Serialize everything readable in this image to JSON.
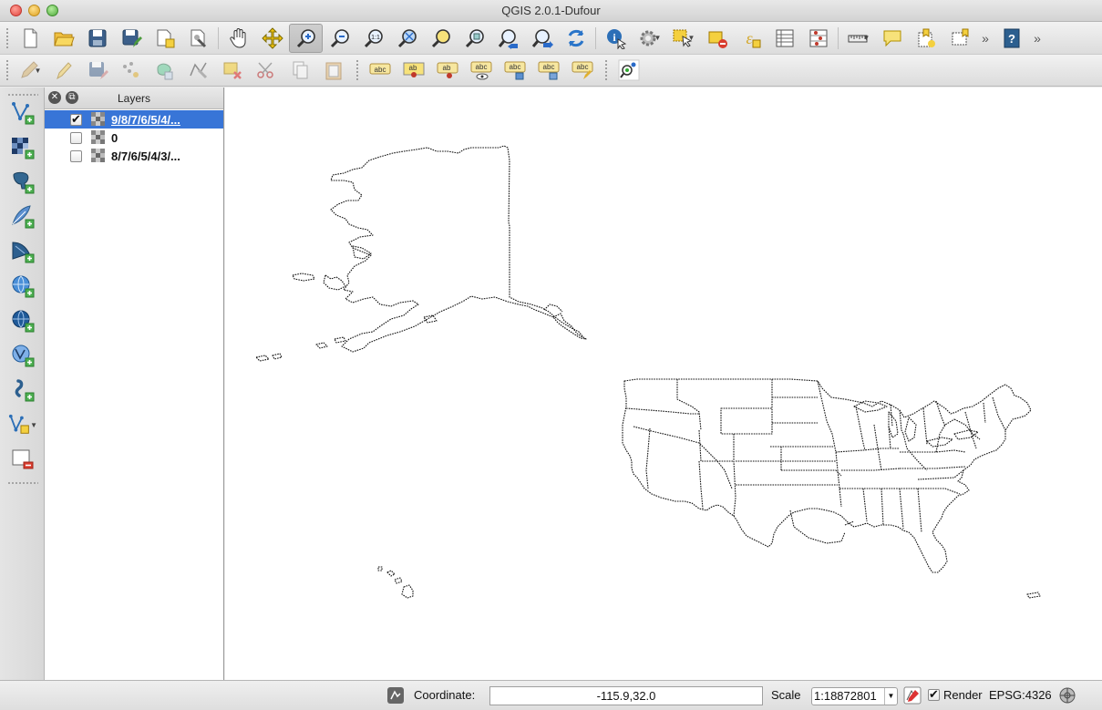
{
  "window": {
    "title": "QGIS 2.0.1-Dufour"
  },
  "toolbar1": {
    "buttons": [
      {
        "name": "new-project-icon"
      },
      {
        "name": "open-project-icon"
      },
      {
        "name": "save-project-icon"
      },
      {
        "name": "save-as-icon"
      },
      {
        "name": "new-print-composer-icon"
      },
      {
        "name": "composer-manager-icon"
      },
      {
        "name": "pan-map-icon"
      },
      {
        "name": "pan-to-selection-icon"
      },
      {
        "name": "zoom-in-icon",
        "active": true
      },
      {
        "name": "zoom-out-icon"
      },
      {
        "name": "zoom-actual-size-icon"
      },
      {
        "name": "zoom-full-icon"
      },
      {
        "name": "zoom-to-selection-icon"
      },
      {
        "name": "zoom-to-layer-icon"
      },
      {
        "name": "zoom-last-icon"
      },
      {
        "name": "zoom-next-icon"
      },
      {
        "name": "refresh-icon"
      },
      {
        "name": "identify-icon"
      },
      {
        "name": "run-feature-action-icon"
      },
      {
        "name": "select-features-icon"
      },
      {
        "name": "deselect-icon"
      },
      {
        "name": "field-calculator-icon"
      },
      {
        "name": "attribute-table-icon"
      },
      {
        "name": "statistics-icon"
      },
      {
        "name": "measure-line-icon"
      },
      {
        "name": "map-tips-icon"
      },
      {
        "name": "new-bookmark-icon"
      },
      {
        "name": "show-bookmarks-icon"
      }
    ],
    "overflow": "»"
  },
  "toolbar2": {
    "buttons": [
      {
        "name": "current-edits-icon"
      },
      {
        "name": "toggle-editing-icon"
      },
      {
        "name": "save-layer-edits-icon"
      },
      {
        "name": "add-feature-icon"
      },
      {
        "name": "move-feature-icon"
      },
      {
        "name": "node-tool-icon"
      },
      {
        "name": "delete-selected-icon"
      },
      {
        "name": "cut-features-icon"
      },
      {
        "name": "copy-features-icon"
      },
      {
        "name": "paste-features-icon"
      },
      {
        "name": "layer-labeling-icon"
      },
      {
        "name": "highlight-pinned-labels-icon"
      },
      {
        "name": "pin-label-icon"
      },
      {
        "name": "show-hide-labels-icon"
      },
      {
        "name": "move-label-icon"
      },
      {
        "name": "rotate-label-icon"
      },
      {
        "name": "change-label-icon"
      },
      {
        "name": "plugin-tool-icon"
      }
    ],
    "abc": "abc",
    "ab": "ab"
  },
  "lefttoolbar": {
    "buttons": [
      {
        "name": "add-vector-layer-icon"
      },
      {
        "name": "add-raster-layer-icon"
      },
      {
        "name": "add-postgis-layer-icon"
      },
      {
        "name": "add-spatialite-layer-icon"
      },
      {
        "name": "add-mssql-layer-icon"
      },
      {
        "name": "add-wms-layer-icon"
      },
      {
        "name": "add-wcs-layer-icon"
      },
      {
        "name": "add-wfs-layer-icon"
      },
      {
        "name": "add-delimited-text-icon"
      },
      {
        "name": "new-shapefile-layer-icon"
      },
      {
        "name": "remove-layer-icon"
      }
    ]
  },
  "layers_panel": {
    "title": "Layers",
    "layers": [
      {
        "name": "9/8/7/6/5/4/...",
        "checked": true,
        "selected": true
      },
      {
        "name": "0",
        "checked": false,
        "selected": false
      },
      {
        "name": "8/7/6/5/4/3/...",
        "checked": false,
        "selected": false
      }
    ]
  },
  "statusbar": {
    "coordinate_label": "Coordinate:",
    "coordinate_value": "-115.9,32.0",
    "scale_label": "Scale",
    "scale_value": "1:18872801",
    "render_label": "Render",
    "render_checked": true,
    "crs": "EPSG:4326"
  }
}
